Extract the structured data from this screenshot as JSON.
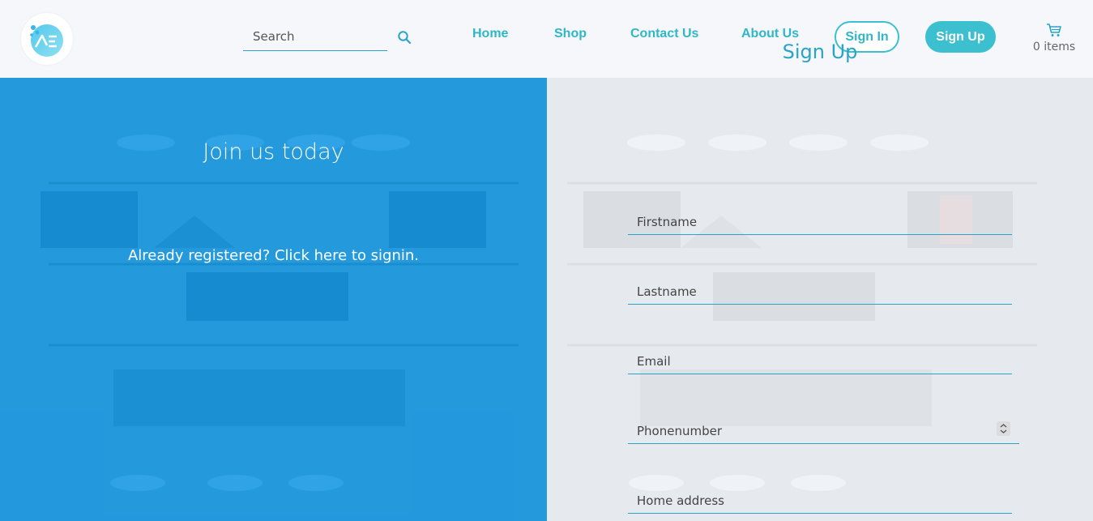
{
  "header": {
    "logo_icon": "brand-logo-icon",
    "search": {
      "placeholder": "Search",
      "icon": "search-icon"
    },
    "nav": {
      "home": "Home",
      "shop": "Shop",
      "contact": "Contact Us",
      "about": "About Us"
    },
    "sign_in_label": "Sign In",
    "sign_up_label": "Sign Up",
    "cart": {
      "icon": "cart-icon",
      "count_label": "0 items"
    }
  },
  "left_panel": {
    "title": "Join us today",
    "signin_prompt": "Already registered? Click here to signin."
  },
  "form": {
    "title": "Sign Up",
    "firstname_placeholder": "Firstname",
    "lastname_placeholder": "Lastname",
    "email_placeholder": "Email",
    "phone_placeholder": "Phonenumber",
    "address_placeholder": "Home address"
  },
  "colors": {
    "accent": "#3cc0d0",
    "nav_text": "#2fb7c9",
    "left_panel": "#1096e2",
    "underline": "#2aa3c9"
  }
}
